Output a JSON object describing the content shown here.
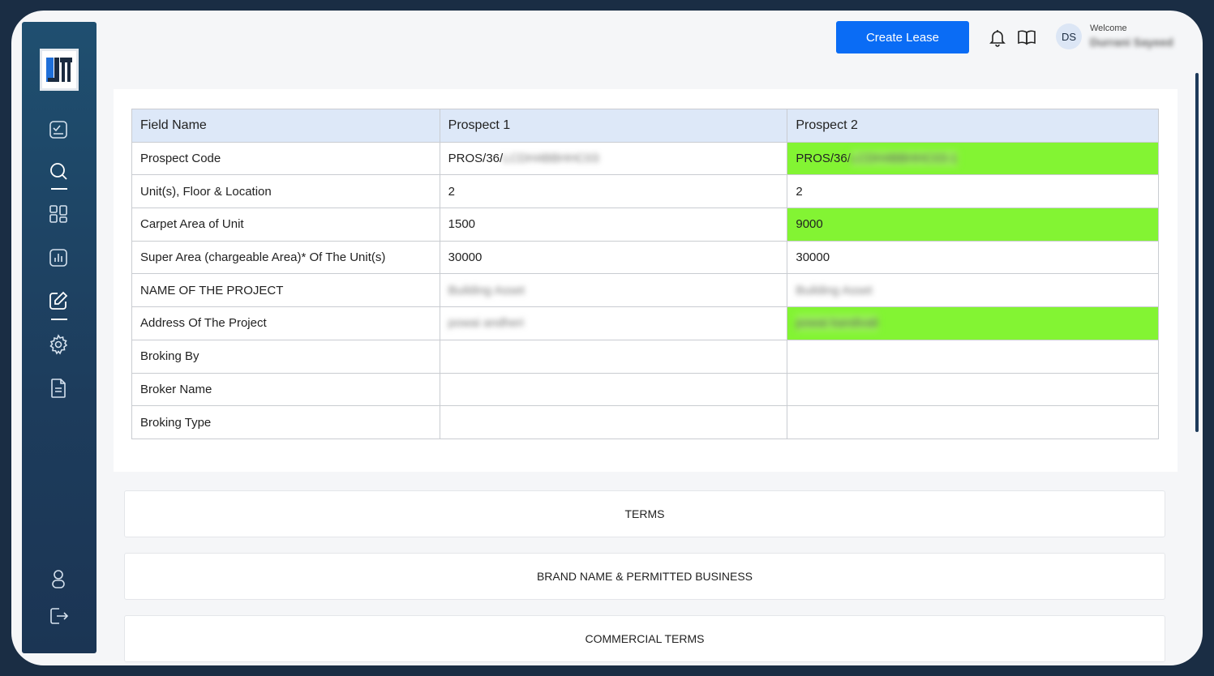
{
  "topbar": {
    "create_lease_label": "Create Lease",
    "avatar_initials": "DS",
    "welcome_label": "Welcome",
    "username": "Durrani Sayeed"
  },
  "table": {
    "headers": [
      "Field Name",
      "Prospect 1",
      "Prospect 2"
    ],
    "rows": [
      {
        "field": "Prospect Code",
        "p1_prefix": "PROS/36/",
        "p1_blur": "LCDH4BBHHC03",
        "p2_prefix": "PROS/36/",
        "p2_blur": "LCDH4BBHHC03-1"
      },
      {
        "field": "Unit(s), Floor & Location",
        "p1": "2",
        "p2": "2"
      },
      {
        "field": "Carpet Area of Unit",
        "p1": "1500",
        "p2": "9000"
      },
      {
        "field": "Super Area (chargeable Area)* Of The Unit(s)",
        "p1": "30000",
        "p2": "30000"
      },
      {
        "field": "NAME OF THE PROJECT",
        "p1": "Building Asset",
        "p2": "Building Asset"
      },
      {
        "field": "Address Of The Project",
        "p1": "powai andheri",
        "p2": "powai kandivali"
      },
      {
        "field": "Broking By",
        "p1": "",
        "p2": ""
      },
      {
        "field": "Broker Name",
        "p1": "",
        "p2": ""
      },
      {
        "field": "Broking Type",
        "p1": "",
        "p2": ""
      }
    ]
  },
  "sections": {
    "terms": "TERMS",
    "brand": "BRAND NAME & PERMITTED BUSINESS",
    "commercial": "COMMERCIAL TERMS"
  },
  "colors": {
    "accent": "#0a6cf5",
    "highlight": "#83f433",
    "sidebar": "#1d3c5c"
  }
}
